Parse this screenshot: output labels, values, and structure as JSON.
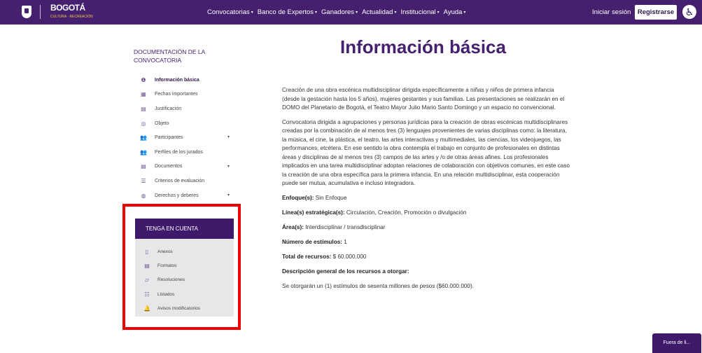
{
  "header": {
    "brand": "BOGOTÁ",
    "brand_sub": "CULTURA · RECREACIÓN",
    "nav": [
      {
        "label": "Convocatorias",
        "caret": "▾"
      },
      {
        "label": "Banco de Expertos",
        "caret": "▾"
      },
      {
        "label": "Ganadores",
        "caret": "▾"
      },
      {
        "label": "Actualidad",
        "caret": "▾"
      },
      {
        "label": "Institucional",
        "caret": "▾"
      },
      {
        "label": "Ayuda",
        "caret": "▾"
      }
    ],
    "login": "Iniciar sesión",
    "register": "Registrarse",
    "accessibility_icon": "accessibility-icon"
  },
  "sidebar": {
    "title": "DOCUMENTACIÓN DE LA CONVOCATORIA",
    "items": [
      {
        "label": "Información básica",
        "icon": "info-icon",
        "glyph": "❶"
      },
      {
        "label": "Fechas importantes",
        "icon": "calendar-icon",
        "glyph": "▦"
      },
      {
        "label": "Justificación",
        "icon": "document-icon",
        "glyph": "▤"
      },
      {
        "label": "Objeto",
        "icon": "target-icon",
        "glyph": "◎"
      },
      {
        "label": "Participantes",
        "icon": "users-icon",
        "glyph": "👥",
        "expand": "▾"
      },
      {
        "label": "Perfiles de los jurados",
        "icon": "users-icon",
        "glyph": "👥"
      },
      {
        "label": "Documentos",
        "icon": "file-icon",
        "glyph": "▤",
        "expand": "▾"
      },
      {
        "label": "Criterios de evaluación",
        "icon": "list-icon",
        "glyph": "☰"
      },
      {
        "label": "Derechos y deberes",
        "icon": "globe-icon",
        "glyph": "◍",
        "expand": "▾"
      }
    ]
  },
  "tenga": {
    "title": "TENGA EN CUENTA",
    "items": [
      {
        "label": "Anexos",
        "icon": "attachment-icon",
        "glyph": "▯"
      },
      {
        "label": "Formatos",
        "icon": "file-icon",
        "glyph": "▤"
      },
      {
        "label": "Resoluciones",
        "icon": "file-edit-icon",
        "glyph": "▱"
      },
      {
        "label": "Listados",
        "icon": "list-icon",
        "glyph": "☷"
      },
      {
        "label": "Avisos modificatorios",
        "icon": "bell-icon",
        "glyph": "🔔"
      }
    ]
  },
  "main": {
    "title": "Información básica",
    "paragraphs": [
      "Creación de una obra escénica multidisciplinar dirigida específicamente a niñas y niños de primera infancia (desde la gestación hasta los 5 años), mujeres gestantes y sus familias. Las presentaciones se realizarán en el DOMO del Planetario de Bogotá, el Teatro Mayor Julio Mario Santo Domingo y un espacio no convencional.",
      "Convocatoria dirigida a agrupaciones y personas jurídicas para la creación de obras escénicas multidisciplinares creadas por la combinación de al menos tres (3) lenguajes provenientes de varias disciplinas como:  la literatura, la música, el cine, la plástica, el teatro, las artes interactivas y multimediales, las ciencias, los videojuegos, las performances, etcétera.  En ese sentido la obra contempla el trabajo en conjunto de profesionales en distintas áreas y disciplinas de al menos tres (3) campos de las artes y /o de otras áreas afines. Los profesionales implicados en una tarea multidisciplinar adoptan relaciones de colaboración con objetivos comunes, en este caso la creación de una obra específica para la primera infancia. En una relación multidisciplinar, esta cooperación puede ser mutua, acumulativa e incluso integradora."
    ],
    "fields": [
      {
        "label": "Enfoque(s):",
        "value": "Sin Enfoque"
      },
      {
        "label": "Línea(s) estratégica(s):",
        "value": "Circulación, Creación, Promoción o divulgación"
      },
      {
        "label": "Área(s):",
        "value": "Interdisciplinar / transdisciplinar"
      },
      {
        "label": "Número de estímulos:",
        "value": "1"
      },
      {
        "label": "Total de recursos:",
        "value": "$ 60.000.000"
      },
      {
        "label": "Descripción general de los recursos a otorgar:",
        "value": ""
      }
    ],
    "resources_text": "Se otorgarán un (1) estímulos de sesenta millones de pesos ($60.000.000)."
  },
  "float_button": "Fuera de li..."
}
